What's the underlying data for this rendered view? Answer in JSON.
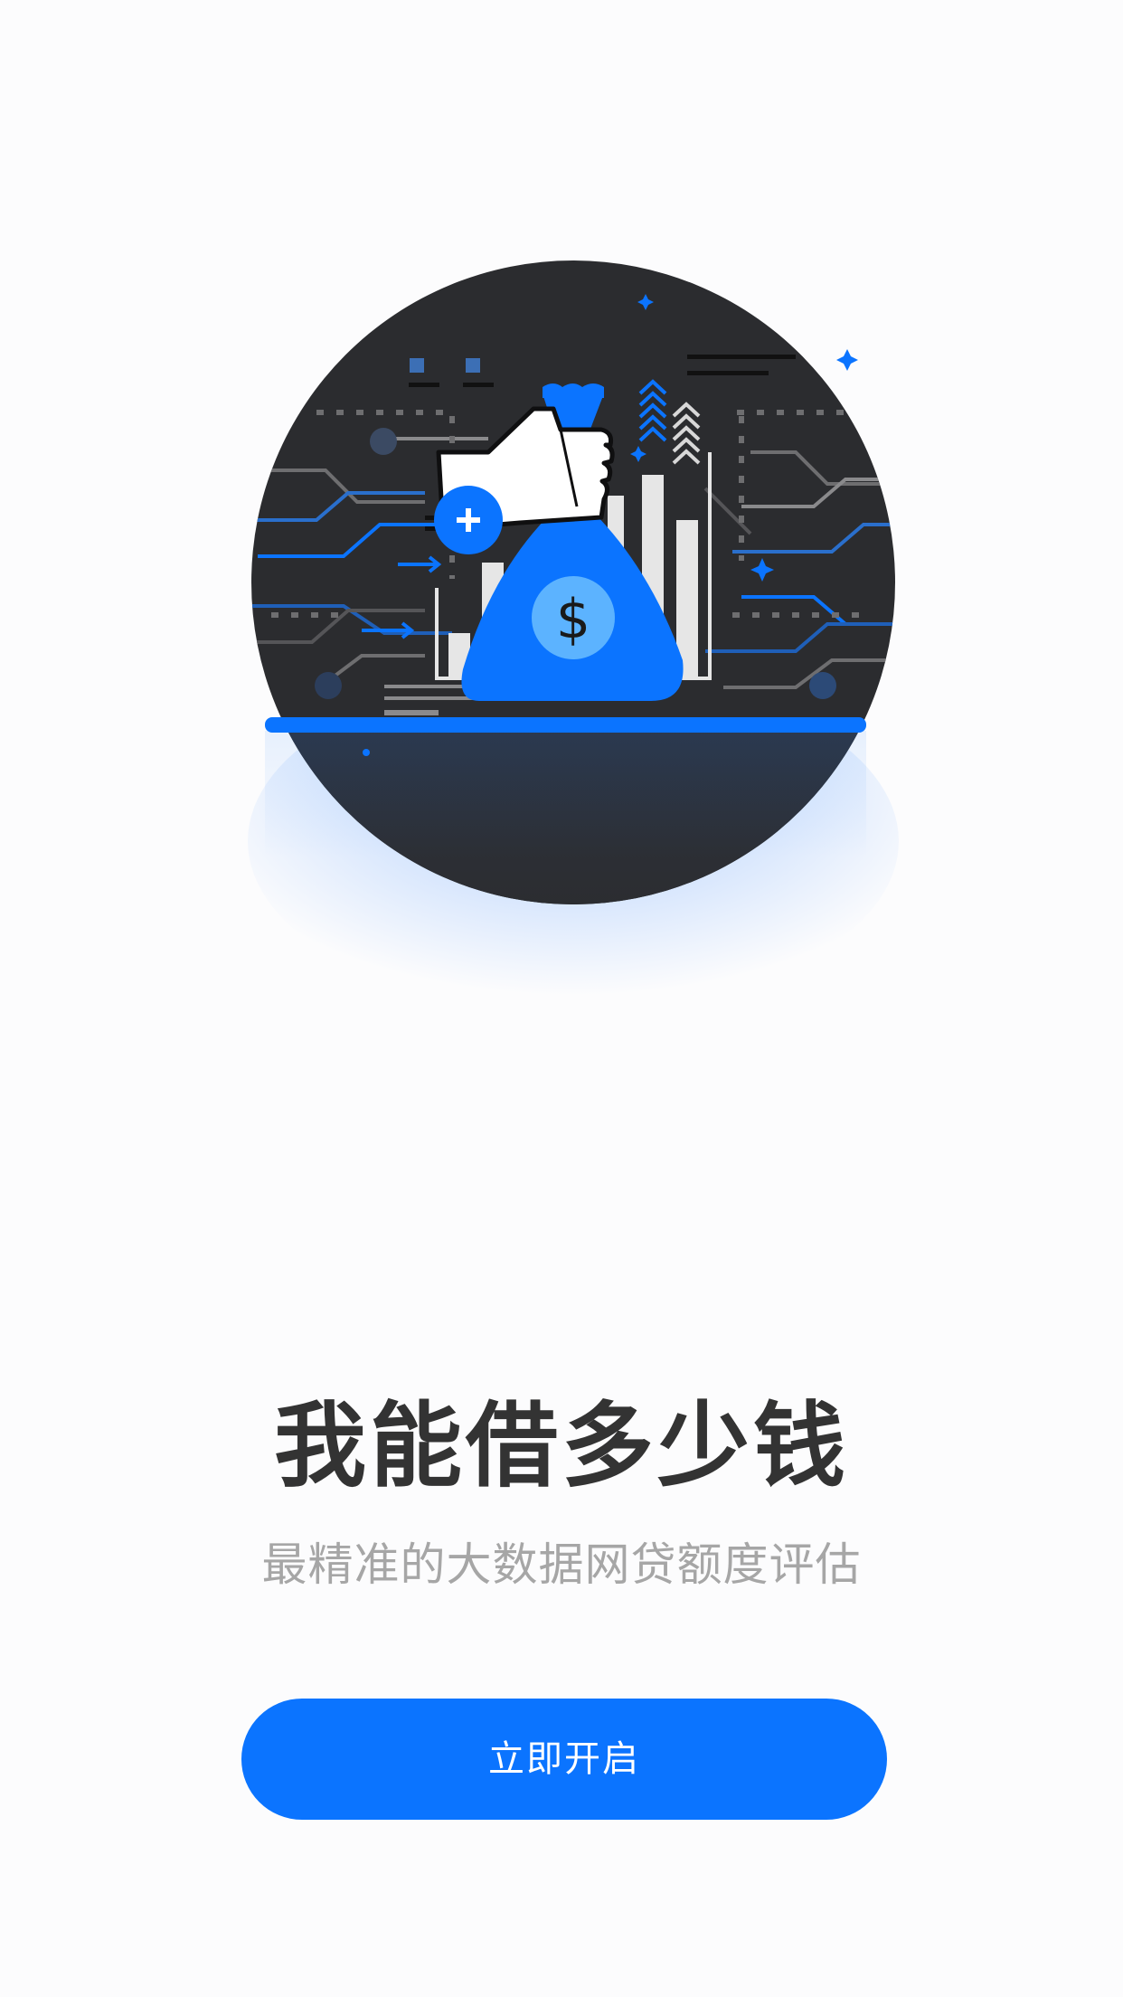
{
  "onboarding": {
    "title": "我能借多少钱",
    "subtitle": "最精准的大数据网贷额度评估",
    "cta_label": "立即开启"
  },
  "theme": {
    "accent": "#0b74ff",
    "dark": "#2b2c2f",
    "title_color": "#333333",
    "subtitle_color": "#a6a6a6",
    "background": "#fcfcfd"
  },
  "illustration": {
    "icons": [
      "hand-icon",
      "money-bag-icon",
      "dollar-icon",
      "plus-icon",
      "bar-chart-icon",
      "up-arrows-icon",
      "sparkle-icon",
      "circuit-lines"
    ]
  }
}
